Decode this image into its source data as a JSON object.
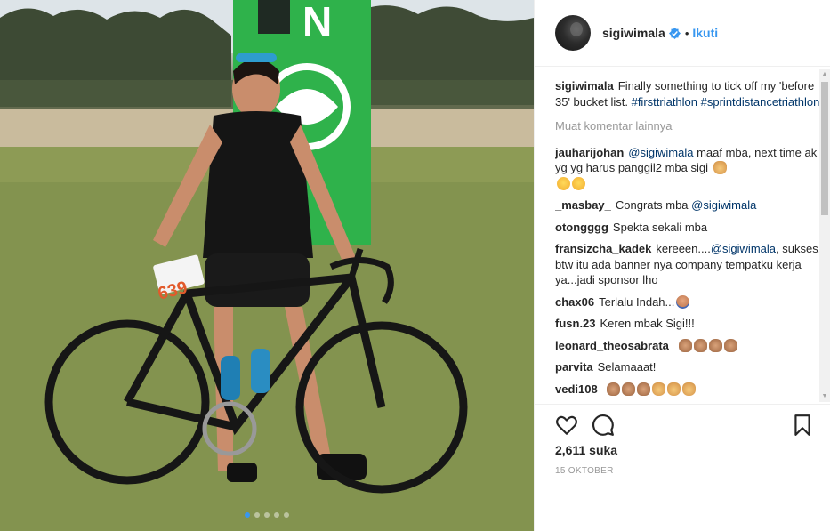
{
  "photo": {
    "alt_visible": "",
    "race_number": "639",
    "carousel": {
      "count": 5,
      "active": 0
    }
  },
  "header": {
    "username": "sigiwimala",
    "verified": true,
    "separator": "•",
    "follow_label": "Ikuti",
    "avatar_icon": "avatar"
  },
  "caption": {
    "username": "sigiwimala",
    "text": "Finally something to tick off my 'before 35' bucket list.",
    "tags": [
      "#firsttriathlon",
      "#sprintdistancetriathlon"
    ]
  },
  "load_more_label": "Muat komentar lainnya",
  "comments": [
    {
      "user": "jauharijohan",
      "mention": "@sigiwimala",
      "text": "maaf mba, next time ak yg yg harus panggil2 mba sigi",
      "emojis": [
        "e-hand",
        "e-cry",
        "e-cry"
      ]
    },
    {
      "user": "_masbay_",
      "text": "Congrats mba",
      "mention_after": "@sigiwimala",
      "emojis": []
    },
    {
      "user": "otongggg",
      "text": "Spekta sekali mba",
      "emojis": []
    },
    {
      "user": "fransizcha_kadek",
      "text_before": "kereeen....",
      "mention": "@sigiwimala",
      "text": ", sukses. btw itu ada banner nya company tempatku kerja ya...jadi sponsor lho",
      "emojis": []
    },
    {
      "user": "chax06",
      "text": "Terlalu Indah...",
      "emojis": [
        "e-pray"
      ]
    },
    {
      "user": "fusn.23",
      "text": "Keren mbak Sigi!!!",
      "emojis": []
    },
    {
      "user": "leonard_theosabrata",
      "text": "",
      "emojis": [
        "e-wave",
        "e-wave",
        "e-wave",
        "e-wave"
      ]
    },
    {
      "user": "parvita",
      "text": "Selamaaat!",
      "emojis": []
    },
    {
      "user": "vedi108",
      "text": "",
      "emojis": [
        "e-wave",
        "e-wave",
        "e-wave",
        "e-hand",
        "e-hand",
        "e-hand"
      ]
    }
  ],
  "actions": {
    "like_icon": "heart-icon",
    "comment_icon": "comment-icon",
    "save_icon": "bookmark-icon"
  },
  "likes_label": "2,611 suka",
  "date_label": "15 OKTOBER",
  "colors": {
    "link": "#003569",
    "follow": "#3897f0",
    "muted": "#999999",
    "verified": "#3897f0"
  }
}
